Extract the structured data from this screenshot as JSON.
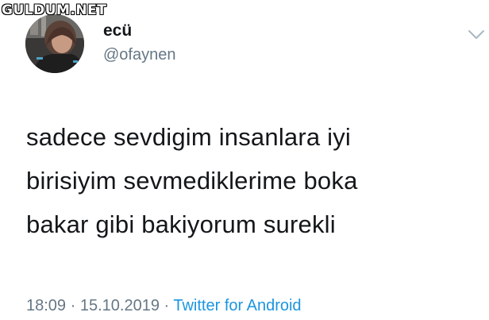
{
  "watermark": {
    "text": "GULDUM.NET"
  },
  "user": {
    "display_name": "ecü",
    "handle": "@ofaynen"
  },
  "tweet": {
    "lines": [
      "sadece sevdigim insanlara iyi",
      "birisiyim sevmediklerime boka",
      "bakar gibi bakiyorum surekli"
    ],
    "time": "18:09",
    "separator1": " · ",
    "date": "15.10.2019",
    "separator2": " · ",
    "source": "Twitter for Android"
  },
  "icons": {
    "menu": "chevron-down-icon"
  },
  "colors": {
    "text": "#14171a",
    "secondary": "#657786",
    "link": "#1b95e0",
    "chevron": "#aab8c2"
  }
}
